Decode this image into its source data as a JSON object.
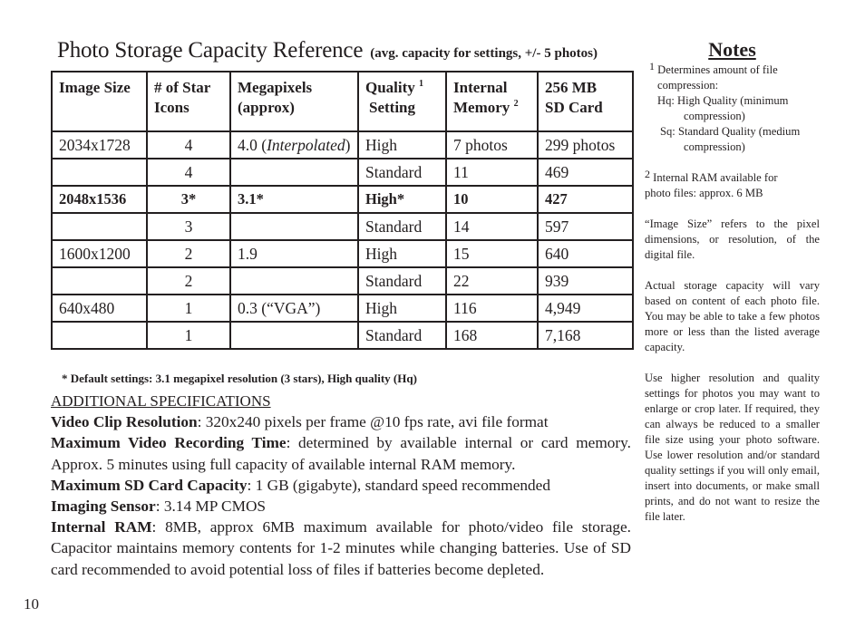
{
  "title": {
    "main": "Photo Storage Capacity Reference",
    "sub": "(avg. capacity for settings, +/- 5 photos)"
  },
  "table": {
    "headers": [
      {
        "line1": "Image Size",
        "line2": "",
        "sup": ""
      },
      {
        "line1": "# of Star",
        "line2": "Icons",
        "sup": ""
      },
      {
        "line1": "Megapixels",
        "line2": "(approx)",
        "sup": ""
      },
      {
        "line1": "Quality",
        "line2": "Setting",
        "sup": "1"
      },
      {
        "line1": "Internal",
        "line2": "Memory",
        "sup": "2"
      },
      {
        "line1": "256 MB",
        "line2": "SD Card",
        "sup": ""
      }
    ],
    "rows": [
      {
        "image_size": "2034x1728",
        "stars": "4",
        "megapixels": "4.0 (",
        "megapixels_italic": "Interpolated",
        "megapixels_after": ")",
        "quality": "High",
        "internal": "7 photos",
        "sd": "299 photos",
        "bold": false
      },
      {
        "image_size": "",
        "stars": "4",
        "megapixels": "",
        "megapixels_italic": "",
        "megapixels_after": "",
        "quality": "Standard",
        "internal": "11",
        "sd": "469",
        "bold": false
      },
      {
        "image_size": "2048x1536",
        "stars": "3*",
        "megapixels": "3.1*",
        "megapixels_italic": "",
        "megapixels_after": "",
        "quality": "High*",
        "internal": "10",
        "sd": "427",
        "bold": true
      },
      {
        "image_size": "",
        "stars": "3",
        "megapixels": "",
        "megapixels_italic": "",
        "megapixels_after": "",
        "quality": "Standard",
        "internal": "14",
        "sd": "597",
        "bold": false
      },
      {
        "image_size": "1600x1200",
        "stars": "2",
        "megapixels": "1.9",
        "megapixels_italic": "",
        "megapixels_after": "",
        "quality": "High",
        "internal": "15",
        "sd": "640",
        "bold": false
      },
      {
        "image_size": "",
        "stars": "2",
        "megapixels": "",
        "megapixels_italic": "",
        "megapixels_after": "",
        "quality": "Standard",
        "internal": "22",
        "sd": "939",
        "bold": false
      },
      {
        "image_size": "640x480",
        "stars": "1",
        "megapixels": "0.3 (“VGA”)",
        "megapixels_italic": "",
        "megapixels_after": "",
        "quality": "High",
        "internal": "116",
        "sd": "4,949",
        "bold": false
      },
      {
        "image_size": "",
        "stars": "1",
        "megapixels": "",
        "megapixels_italic": "",
        "megapixels_after": "",
        "quality": "Standard",
        "internal": "168",
        "sd": "7,168",
        "bold": false
      }
    ],
    "footnote": "* Default settings: 3.1 megapixel resolution (3 stars), High quality (Hq)"
  },
  "specs": {
    "heading": "ADDITIONAL SPECIFICATIONS",
    "items": [
      {
        "label": "Video Clip Resolution",
        "text": ": 320x240 pixels per frame @10 fps rate, avi file format"
      },
      {
        "label": "Maximum Video Recording Time",
        "text": ": determined by available internal or card memory. Approx. 5 minutes using full capacity of available internal RAM memory."
      },
      {
        "label": "Maximum SD Card Capacity",
        "text": ": 1 GB (gigabyte), standard speed recommended"
      },
      {
        "label": "Imaging Sensor",
        "text": ": 3.14 MP CMOS"
      },
      {
        "label": "Internal RAM",
        "text": ": 8MB, approx 6MB maximum available for photo/video file storage. Capacitor maintains memory contents for 1-2 minutes while changing batteries. Use of SD card recommended to avoid potential loss of files if batteries become depleted."
      }
    ]
  },
  "notes": {
    "heading": "Notes",
    "note1_sup": "1",
    "note1_line1": "Determines amount of file",
    "note1_line2": "compression:",
    "note1_hq": "Hq: High Quality (minimum",
    "note1_hq_cont": "compression)",
    "note1_sq": "Sq: Standard Quality (medium",
    "note1_sq_cont": "compression)",
    "note2_sup": "2",
    "note2_line1": "Internal RAM available for",
    "note2_line2": "photo files: approx. 6 MB",
    "para_image_size": "“Image Size” refers to the pixel dimensions, or resolution, of the digital file.",
    "para_actual": "Actual storage capacity will vary based on content of each photo file. You may be able to take a few photos more or less than the listed average capacity.",
    "para_use": "Use higher resolution and quality settings for photos you may want to enlarge or crop later. If required, they can always be reduced to a smaller file size using your photo software. Use lower resolution and/or standard quality settings if you will only email, insert into documents, or make small prints, and do not want to resize the file later."
  },
  "page_number": "10"
}
